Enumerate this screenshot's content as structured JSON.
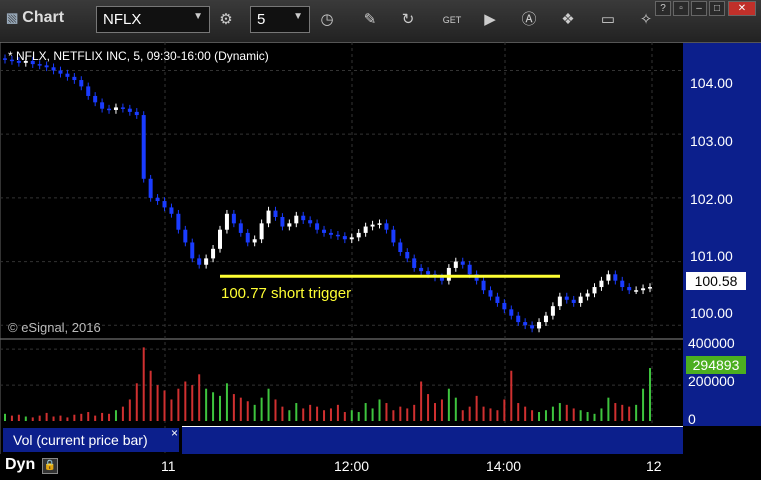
{
  "window": {
    "title": "Chart"
  },
  "toolbar": {
    "symbol": "NFLX",
    "interval": "5",
    "help": "?",
    "win_buttons": [
      "?",
      "▫",
      "–",
      "□",
      "✕"
    ],
    "icons": [
      "gear-icon",
      "clock-icon",
      "pencil-icon",
      "refresh-icon",
      "get-icon",
      "play-icon",
      "alert-icon",
      "link-icon",
      "comment-icon",
      "twitter-icon"
    ]
  },
  "chart": {
    "description": "* NFLX, NETFLIX INC, 5, 09:30-16:00 (Dynamic)",
    "copyright": "© eSignal, 2016",
    "annotation": "100.77 short trigger",
    "last_price": "100.58",
    "last_volume": "294893",
    "volume_label": "Vol (current price bar)",
    "close_x": "×",
    "dyn_label": "Dyn",
    "price_ticks": [
      "104.00",
      "103.00",
      "102.00",
      "101.00",
      "100.00"
    ],
    "volume_ticks": [
      "400000",
      "200000",
      "0"
    ],
    "time_ticks": [
      "11",
      "12:00",
      "14:00",
      "12"
    ]
  },
  "chart_data": {
    "type": "candlestick",
    "title": "NFLX, NETFLIX INC, 5, 09:30-16:00 (Dynamic)",
    "ylim": [
      99.8,
      104.4
    ],
    "trendline": {
      "value": 100.77,
      "label": "100.77 short trigger"
    },
    "colors": {
      "up": "#ffffff",
      "down": "#1a3cff",
      "trigger": "#ffff33",
      "vol_up": "#3ec43e",
      "vol_down": "#d03030"
    },
    "series": [
      {
        "name": "NFLX",
        "close": [
          104.17,
          104.15,
          104.12,
          104.15,
          104.1,
          104.08,
          104.05,
          104.0,
          103.95,
          103.9,
          103.85,
          103.75,
          103.6,
          103.5,
          103.4,
          103.38,
          103.42,
          103.4,
          103.35,
          103.3,
          102.3,
          102.0,
          101.95,
          101.85,
          101.75,
          101.5,
          101.3,
          101.05,
          100.95,
          101.05,
          101.2,
          101.5,
          101.75,
          101.6,
          101.45,
          101.3,
          101.35,
          101.6,
          101.8,
          101.7,
          101.55,
          101.6,
          101.72,
          101.65,
          101.6,
          101.5,
          101.45,
          101.42,
          101.4,
          101.35,
          101.38,
          101.45,
          101.55,
          101.58,
          101.6,
          101.5,
          101.3,
          101.15,
          101.05,
          100.9,
          100.85,
          100.8,
          100.75,
          100.7,
          100.9,
          101.0,
          100.95,
          100.8,
          100.7,
          100.55,
          100.45,
          100.35,
          100.25,
          100.15,
          100.05,
          100.0,
          99.95,
          100.05,
          100.15,
          100.3,
          100.45,
          100.4,
          100.35,
          100.45,
          100.5,
          100.6,
          100.7,
          100.8,
          100.7,
          100.6,
          100.55,
          100.55,
          100.58,
          100.6
        ]
      }
    ],
    "volume": [
      40000,
      30000,
      35000,
      25000,
      20000,
      30000,
      45000,
      25000,
      30000,
      20000,
      35000,
      40000,
      50000,
      30000,
      45000,
      40000,
      60000,
      80000,
      120000,
      210000,
      410000,
      280000,
      200000,
      170000,
      120000,
      180000,
      220000,
      200000,
      260000,
      180000,
      160000,
      140000,
      210000,
      150000,
      130000,
      110000,
      90000,
      130000,
      180000,
      120000,
      80000,
      60000,
      100000,
      70000,
      90000,
      80000,
      60000,
      70000,
      90000,
      50000,
      60000,
      50000,
      100000,
      70000,
      120000,
      100000,
      60000,
      80000,
      70000,
      90000,
      220000,
      150000,
      100000,
      120000,
      180000,
      130000,
      60000,
      80000,
      140000,
      80000,
      70000,
      60000,
      120000,
      280000,
      100000,
      80000,
      60000,
      50000,
      60000,
      80000,
      100000,
      90000,
      70000,
      60000,
      50000,
      40000,
      70000,
      130000,
      100000,
      90000,
      80000,
      90000,
      180000,
      294893
    ],
    "vol_ylim": [
      0,
      440000
    ]
  }
}
